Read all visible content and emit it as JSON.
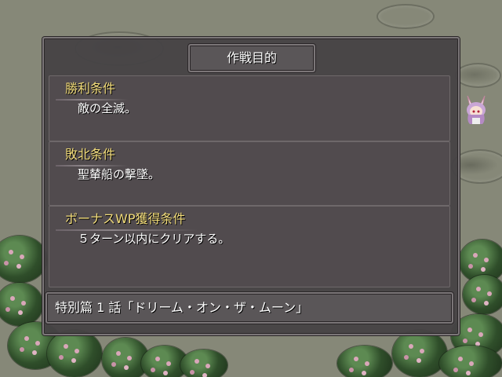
{
  "header": {
    "title": "作戦目的"
  },
  "sections": [
    {
      "label": "勝利条件",
      "text": "敵の全滅。"
    },
    {
      "label": "敗北条件",
      "text": "聖輦船の撃墜。"
    },
    {
      "label": "ボーナスWP獲得条件",
      "text": "５ターン以内にクリアする。"
    }
  ],
  "stage": {
    "title": "特別篇 1 話「ドリーム・オン・ザ・ムーン」"
  },
  "colors": {
    "label": "#f2dc7a",
    "text": "#ffffff",
    "panel": "#514b4e"
  }
}
